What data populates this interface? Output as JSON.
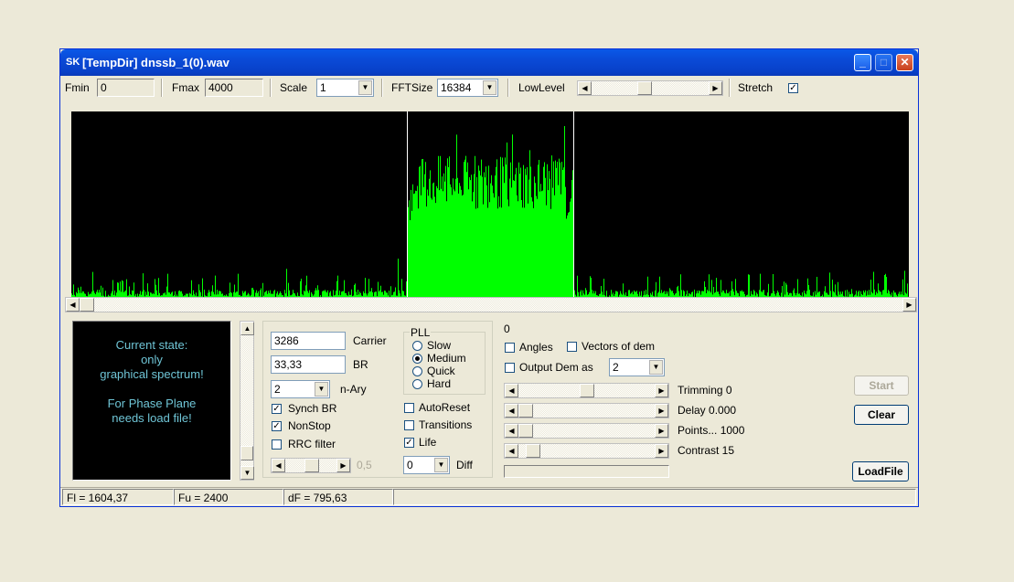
{
  "window": {
    "title": "[TempDir] dnssb_1(0).wav",
    "minimize_glyph": "_",
    "maximize_glyph": "□",
    "close_glyph": "✕",
    "app_icon": "SK"
  },
  "toolbar": {
    "fmin_label": "Fmin",
    "fmin_value": "0",
    "fmax_label": "Fmax",
    "fmax_value": "4000",
    "scale_label": "Scale",
    "scale_value": "1",
    "fftsize_label": "FFTSize",
    "fftsize_value": "16384",
    "lowlevel_label": "LowLevel",
    "lowlevel_position": 0.45,
    "stretch_label": "Stretch",
    "stretch_checked": true
  },
  "spectrum": {
    "trace_color": "#00ff00",
    "background_color": "#000000",
    "marker_color": "#ffffff",
    "band_start": 0.401,
    "band_end": 0.599,
    "scroll_position": 0.0
  },
  "state_panel": {
    "text_color": "#6fc5d6",
    "line1": "Current state:",
    "line2": "only",
    "line3": "graphical spectrum!",
    "line4": "For Phase Plane",
    "line5": "needs load file!"
  },
  "controls": {
    "carrier_value": "3286",
    "carrier_label": "Carrier",
    "br_value": "33,33",
    "br_label": "BR",
    "nary_value": "2",
    "nary_label": "n-Ary",
    "synch_br_label": "Synch BR",
    "synch_br_checked": true,
    "nonstop_label": "NonStop",
    "nonstop_checked": true,
    "rrc_label": "RRC filter",
    "rrc_checked": false,
    "rrc_value": "0,5",
    "pll_label": "PLL",
    "pll_options": [
      "Slow",
      "Medium",
      "Quick",
      "Hard"
    ],
    "pll_selected": 1,
    "autoreset_label": "AutoReset",
    "autoreset_checked": false,
    "transitions_label": "Transitions",
    "transitions_checked": false,
    "life_label": "Life",
    "life_checked": true,
    "diff_value": "0",
    "diff_label": "Diff"
  },
  "right": {
    "zero_label": "0",
    "angles_label": "Angles",
    "vectors_label": "Vectors of dem",
    "output_dem_label": "Output Dem as",
    "output_dem_value": "2",
    "trimming_label": "Trimming 0",
    "trimming_position": 0.5,
    "delay_label": "Delay  0.000",
    "delay_position": 0.0,
    "points_label": "Points... 1000",
    "points_position": 0.0,
    "contrast_label": "Contrast 15",
    "contrast_position": 0.06
  },
  "buttons": {
    "start": "Start",
    "clear": "Clear",
    "loadfile": "LoadFile"
  },
  "status": {
    "fl": "Fl = 1604,37",
    "fu": "Fu = 2400",
    "df": "dF = 795,63"
  }
}
